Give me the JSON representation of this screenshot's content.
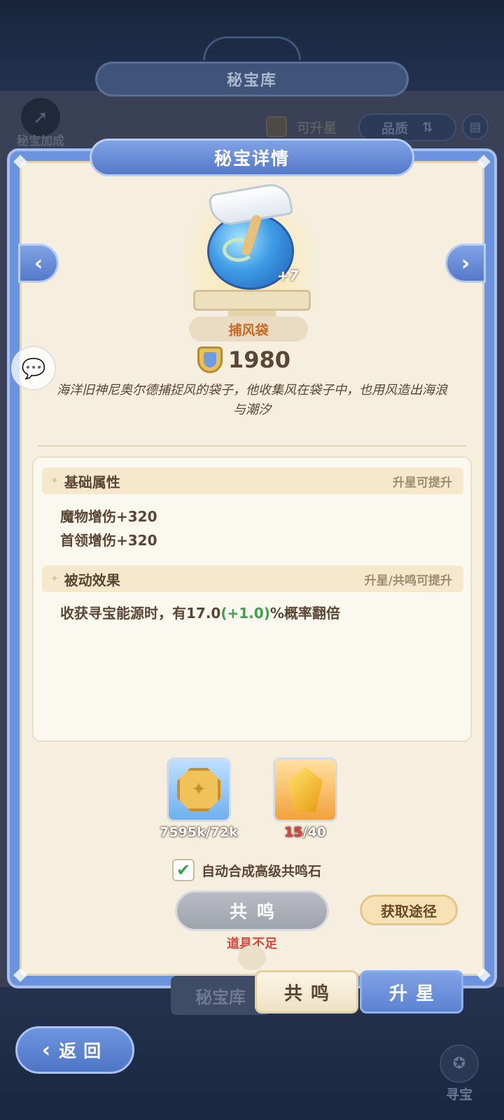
{
  "background": {
    "title": "秘宝库",
    "bonus_label": "秘宝加成",
    "filter_label": "可升星",
    "sort_label": "品质"
  },
  "modal": {
    "title": "秘宝详情",
    "item": {
      "name": "捕风袋",
      "level": "+7",
      "power": "1980",
      "description": "海洋旧神尼奥尔德捕捉风的袋子，他收集风在袋子中，也用风造出海浪与潮汐"
    },
    "basic": {
      "title": "基础属性",
      "hint": "升星可提升",
      "lines": [
        "魔物增伤+320",
        "首领增伤+320"
      ]
    },
    "passive": {
      "title": "被动效果",
      "hint": "升星/共鸣可提升",
      "text_prefix": "收获寻宝能源时，有17.0",
      "text_bonus": "(+1.0)",
      "text_suffix": "%概率翻倍"
    },
    "costs": {
      "coin": {
        "have": "7595k",
        "need": "/72k",
        "icon": "coin-icon"
      },
      "gem": {
        "have": "15",
        "need": "/40",
        "icon": "gem-icon"
      }
    },
    "auto_combine_label": "自动合成高级共鸣石",
    "auto_combine_checked": true,
    "resonate_button": "共鸣",
    "source_button": "获取途径",
    "insufficient_text": "道具不足"
  },
  "tabs": {
    "vault": "秘宝库",
    "resonate": "共鸣",
    "upstar": "升星"
  },
  "back_button": "返回",
  "hunt_button": "寻宝",
  "colors": {
    "accent_blue": "#6c94de",
    "panel_cream": "#f6efdf",
    "warning_red": "#e0453c",
    "bonus_green": "#3ea04a"
  }
}
